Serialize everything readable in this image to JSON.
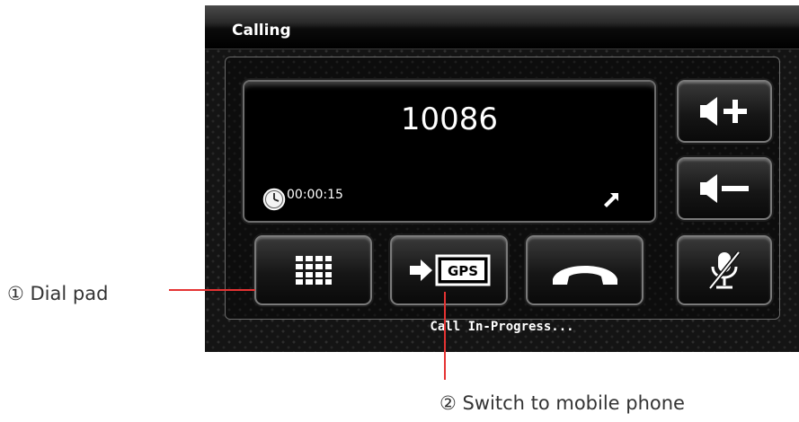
{
  "window": {
    "title": "Calling"
  },
  "call": {
    "number": "10086",
    "duration": "00:00:15",
    "status": "Call In-Progress..."
  },
  "buttons": [
    {
      "id": "volume-up",
      "icon": "volume-up-icon"
    },
    {
      "id": "volume-down",
      "icon": "volume-down-icon"
    },
    {
      "id": "dial-pad",
      "icon": "keypad-icon"
    },
    {
      "id": "switch-to-mobile",
      "icon": "arrow-gps-icon",
      "icon_text": "GPS"
    },
    {
      "id": "hang-up",
      "icon": "handset-icon"
    },
    {
      "id": "mute",
      "icon": "mic-muted-icon"
    }
  ],
  "annotations": {
    "dial_pad": "① Dial pad",
    "switch": "② Switch to mobile phone",
    "leader_color": "#e53333"
  }
}
